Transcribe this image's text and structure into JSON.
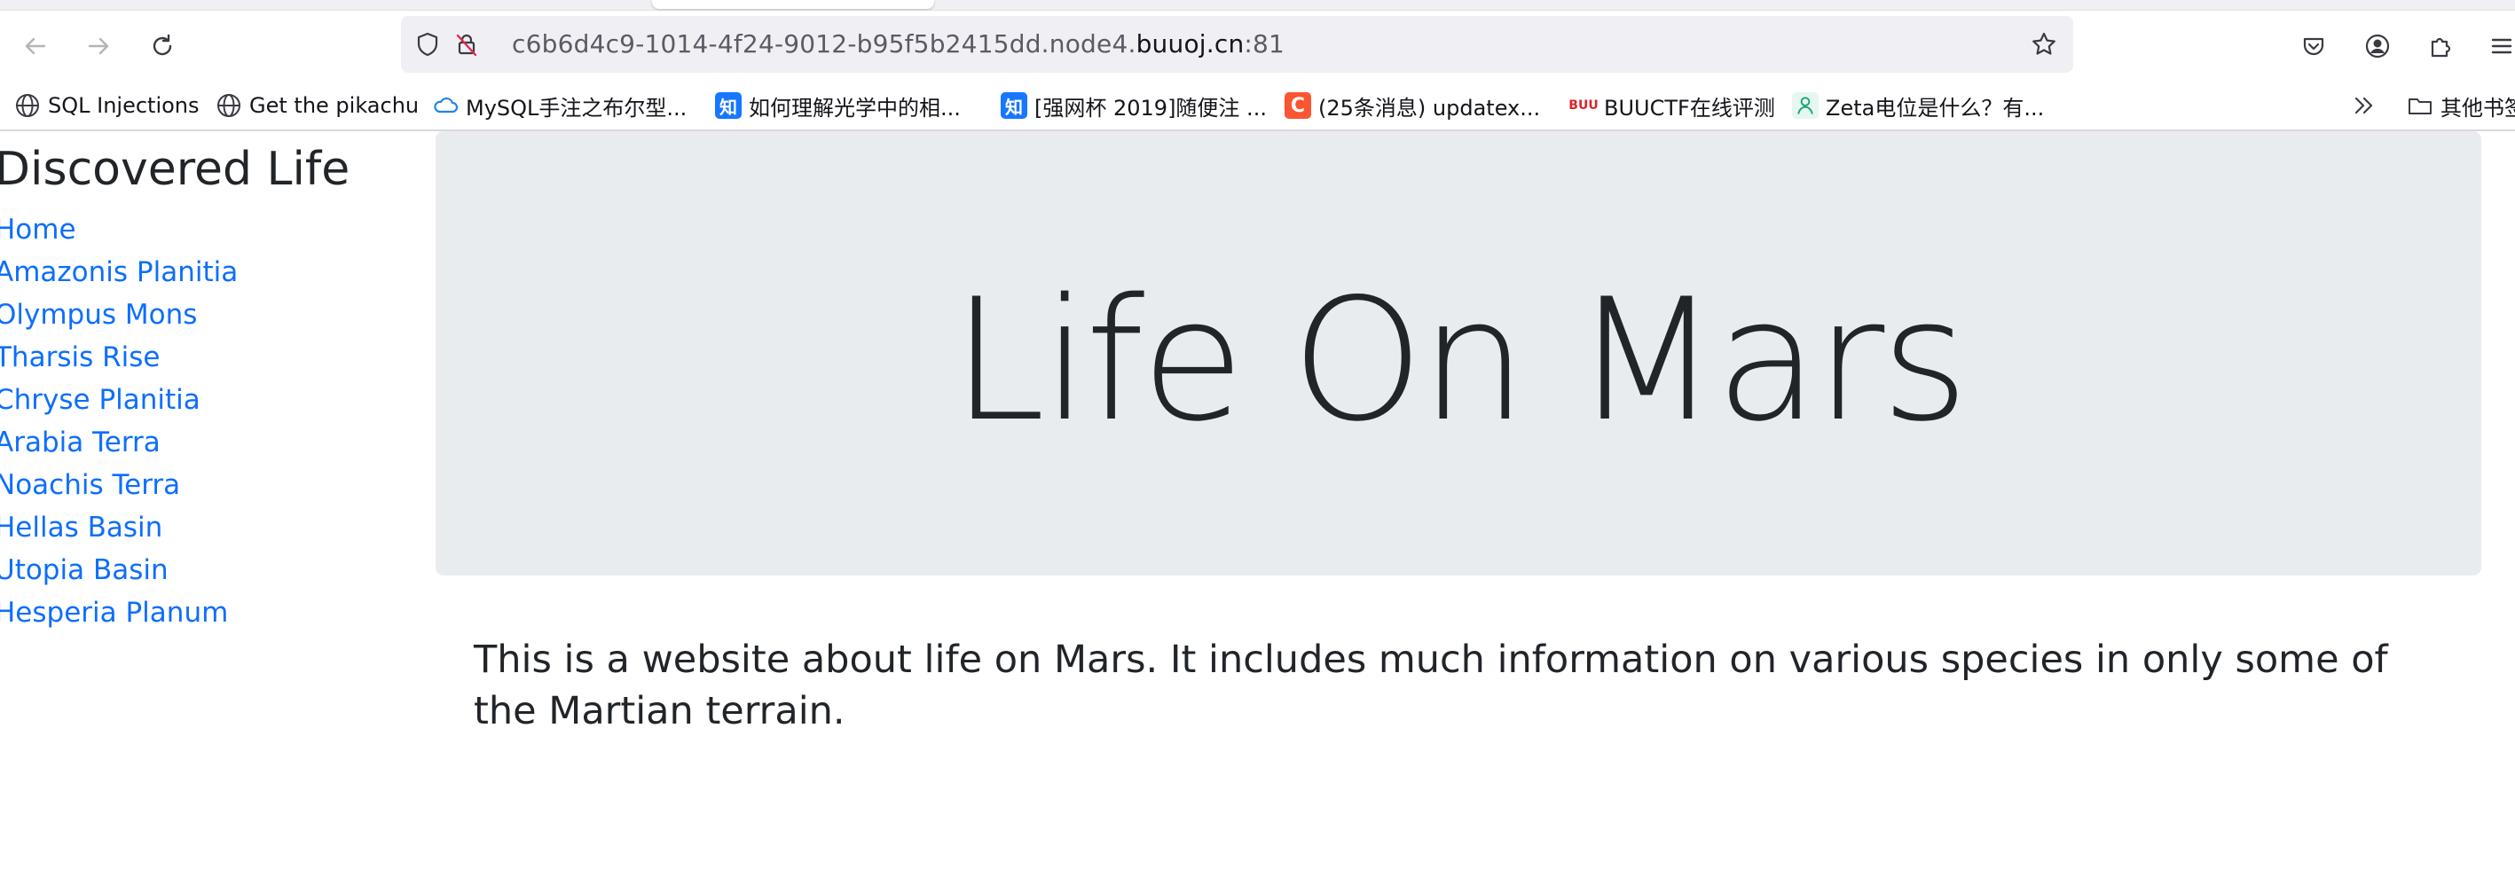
{
  "browser": {
    "url_prefix": "c6b6d4c9-1014-4f24-9012-b95f5b2415dd.node4.",
    "url_domain": "buuoj.cn",
    "url_suffix": ":81",
    "bookmarks": [
      {
        "label": "SQL Injections",
        "icon": "globe-icon"
      },
      {
        "label": "Get the pikachu",
        "icon": "globe-icon"
      },
      {
        "label": "MySQL手注之布尔型...",
        "icon": "cloud-icon"
      },
      {
        "label": "如何理解光学中的相...",
        "icon": "zhihu-icon",
        "icon_text": "知"
      },
      {
        "label": "[强网杯 2019]随便注 ...",
        "icon": "zhihu-icon",
        "icon_text": "知"
      },
      {
        "label": "(25条消息) updatex...",
        "icon": "csdn-icon",
        "icon_text": "C"
      },
      {
        "label": "BUUCTF在线评测",
        "icon": "buuctf-icon",
        "icon_text": "BUU"
      },
      {
        "label": "Zeta电位是什么？有...",
        "icon": "zeta-icon"
      }
    ],
    "other_bookmarks": "其他书签"
  },
  "sidebar": {
    "title": "Discovered Life",
    "links": [
      "Home",
      "Amazonis Planitia",
      "Olympus Mons",
      "Tharsis Rise",
      "Chryse Planitia",
      "Arabia Terra",
      "Noachis Terra",
      "Hellas Basin",
      "Utopia Basin",
      "Hesperia Planum"
    ]
  },
  "main": {
    "heading": "Life On Mars",
    "lead": "This is a website about life on Mars. It includes much information on various species in only some of the Martian terrain."
  },
  "colors": {
    "link": "#0d6efd",
    "jumbotron_bg": "#e9ecef",
    "text": "#212529"
  }
}
